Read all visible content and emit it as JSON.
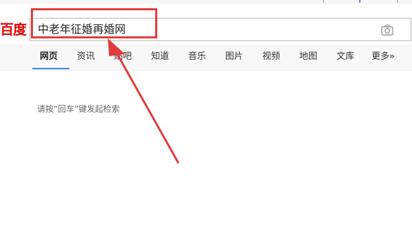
{
  "logo": {
    "text": "百度"
  },
  "search": {
    "value": "中老年征婚再婚网"
  },
  "nav": {
    "tabs": [
      {
        "label": "网页",
        "active": true
      },
      {
        "label": "资讯"
      },
      {
        "label": "贴吧"
      },
      {
        "label": "知道"
      },
      {
        "label": "音乐"
      },
      {
        "label": "图片"
      },
      {
        "label": "视频"
      },
      {
        "label": "地图"
      },
      {
        "label": "文库"
      },
      {
        "label": "更多»"
      }
    ]
  },
  "hint": {
    "text": "请按“回车”键发起检索"
  },
  "icons": {
    "camera": "camera-icon",
    "annotation_arrow": "red-arrow-icon",
    "annotation_box": "red-highlight-box"
  },
  "colors": {
    "logo_red": "#e10601",
    "annotation_red": "#e23a3a",
    "active_tab_blue": "#3385ff"
  }
}
